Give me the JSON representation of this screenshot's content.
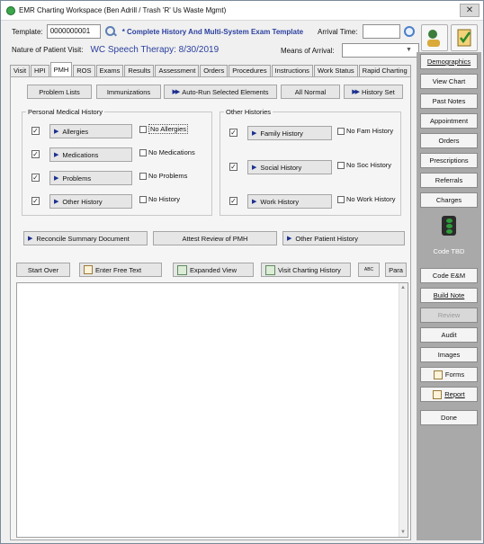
{
  "window": {
    "title": "EMR Charting Workspace (Ben Adrill / Trash 'R' Us Waste Mgmt)",
    "close": "✕"
  },
  "header": {
    "template_label": "Template:",
    "template_value": "0000000001",
    "template_name": "* Complete History And Multi-System Exam Template",
    "arrival_label": "Arrival Time:",
    "arrival_value": "",
    "visit_label": "Nature of Patient Visit:",
    "visit_value": "WC Speech Therapy:  8/30/2019",
    "means_label": "Means of Arrival:",
    "means_value": ""
  },
  "tabs": [
    "Visit",
    "HPI",
    "PMH",
    "ROS",
    "Exams",
    "Results",
    "Assessment",
    "Orders",
    "Procedures",
    "Instructions",
    "Work Status",
    "Rapid Charting"
  ],
  "active_tab": "PMH",
  "toolbar": {
    "problem_lists": "Problem Lists",
    "immunizations": "Immunizations",
    "auto_run": "Auto-Run Selected Elements",
    "all_normal": "All Normal",
    "history_set": "History Set"
  },
  "pmh": {
    "title": "Personal Medical History",
    "items": [
      {
        "label": "Allergies",
        "checked": "✓",
        "none": "No Allergies"
      },
      {
        "label": "Medications",
        "checked": "✓",
        "none": "No Medications"
      },
      {
        "label": "Problems",
        "checked": "✓",
        "none": "No Problems"
      },
      {
        "label": "Other History",
        "checked": "✓",
        "none": "No History"
      }
    ]
  },
  "other": {
    "title": "Other Histories",
    "items": [
      {
        "label": "Family History",
        "checked": "✓",
        "none": "No Fam History"
      },
      {
        "label": "Social History",
        "checked": "✓",
        "none": "No Soc History"
      },
      {
        "label": "Work History",
        "checked": "✓",
        "none": "No Work History"
      }
    ]
  },
  "actions": {
    "reconcile": "Reconcile Summary Document",
    "attest": "Attest Review of PMH",
    "other_patient": "Other Patient History"
  },
  "editor_bar": {
    "start_over": "Start Over",
    "free_text": "Enter Free Text",
    "expanded": "Expanded View",
    "visit_history": "Visit Charting History",
    "spell": "ABC",
    "para": "Para"
  },
  "sidebar": {
    "demographics": "Demographics",
    "view_chart": "View Chart",
    "past_notes": "Past Notes",
    "appointment": "Appointment",
    "orders": "Orders",
    "prescriptions": "Prescriptions",
    "referrals": "Referrals",
    "charges": "Charges",
    "code_tbd": "Code TBD",
    "code_em": "Code E&M",
    "build_note": "Build Note",
    "review": "Review",
    "audit": "Audit",
    "images": "Images",
    "forms": "Forms",
    "report": "Report",
    "done": "Done"
  }
}
